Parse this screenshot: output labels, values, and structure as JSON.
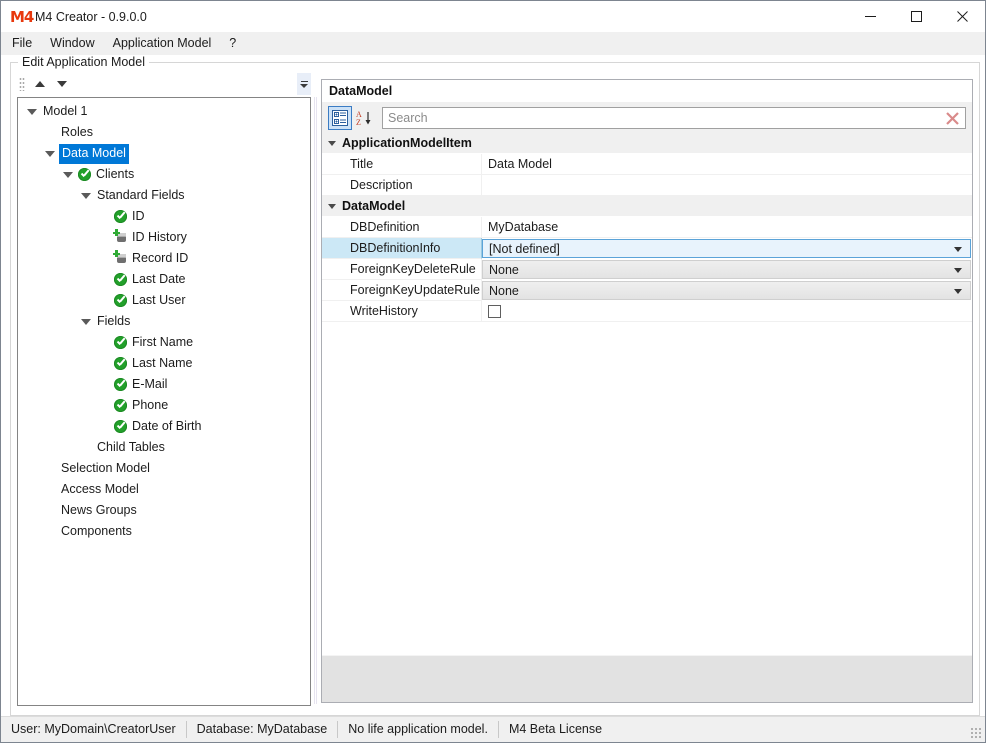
{
  "window": {
    "title": "M4 Creator - 0.9.0.0",
    "logo_text": "M4",
    "minimize_label": "Minimize",
    "maximize_label": "Maximize",
    "close_label": "Close"
  },
  "menubar": {
    "items": [
      {
        "label": "File"
      },
      {
        "label": "Window"
      },
      {
        "label": "Application Model"
      },
      {
        "label": "?"
      }
    ]
  },
  "groupbox": {
    "legend": "Edit Application Model"
  },
  "tree_toolbar": {
    "move_up_label": "Move Up",
    "move_down_label": "Move Down",
    "overflow_label": "Toolbar Overflow"
  },
  "tree": {
    "nodes": [
      {
        "label": "Model 1",
        "indent": 0,
        "expander": "open",
        "icon": "none",
        "selected": false
      },
      {
        "label": "Roles",
        "indent": 1,
        "expander": "none",
        "icon": "none",
        "selected": false
      },
      {
        "label": "Data Model",
        "indent": 1,
        "expander": "open",
        "icon": "none",
        "selected": true
      },
      {
        "label": "Clients",
        "indent": 2,
        "expander": "open",
        "icon": "check",
        "selected": false
      },
      {
        "label": "Standard Fields",
        "indent": 3,
        "expander": "open",
        "icon": "none",
        "selected": false
      },
      {
        "label": "ID",
        "indent": 4,
        "expander": "none",
        "icon": "check",
        "selected": false
      },
      {
        "label": "ID History",
        "indent": 4,
        "expander": "none",
        "icon": "db",
        "selected": false
      },
      {
        "label": "Record ID",
        "indent": 4,
        "expander": "none",
        "icon": "db",
        "selected": false
      },
      {
        "label": "Last Date",
        "indent": 4,
        "expander": "none",
        "icon": "check",
        "selected": false
      },
      {
        "label": "Last User",
        "indent": 4,
        "expander": "none",
        "icon": "check",
        "selected": false
      },
      {
        "label": "Fields",
        "indent": 3,
        "expander": "open",
        "icon": "none",
        "selected": false
      },
      {
        "label": "First Name",
        "indent": 4,
        "expander": "none",
        "icon": "check",
        "selected": false
      },
      {
        "label": "Last Name",
        "indent": 4,
        "expander": "none",
        "icon": "check",
        "selected": false
      },
      {
        "label": "E-Mail",
        "indent": 4,
        "expander": "none",
        "icon": "check",
        "selected": false
      },
      {
        "label": "Phone",
        "indent": 4,
        "expander": "none",
        "icon": "check",
        "selected": false
      },
      {
        "label": "Date of Birth",
        "indent": 4,
        "expander": "none",
        "icon": "check",
        "selected": false
      },
      {
        "label": "Child Tables",
        "indent": 3,
        "expander": "none",
        "icon": "none",
        "selected": false
      },
      {
        "label": "Selection Model",
        "indent": 1,
        "expander": "none",
        "icon": "none",
        "selected": false
      },
      {
        "label": "Access Model",
        "indent": 1,
        "expander": "none",
        "icon": "none",
        "selected": false
      },
      {
        "label": "News Groups",
        "indent": 1,
        "expander": "none",
        "icon": "none",
        "selected": false
      },
      {
        "label": "Components",
        "indent": 1,
        "expander": "none",
        "icon": "none",
        "selected": false
      }
    ]
  },
  "property_pane": {
    "header": "DataModel",
    "toolbar": {
      "categorized_label": "Categorized",
      "alphabetical_label": "Alphabetical",
      "clear_search_label": "Clear Search"
    },
    "search": {
      "value": "",
      "placeholder": "Search"
    },
    "groups": [
      {
        "name": "ApplicationModelItem",
        "expanded": true,
        "rows": [
          {
            "name": "Title",
            "value": "Data Model",
            "editor": "text",
            "selected": false
          },
          {
            "name": "Description",
            "value": "",
            "editor": "text",
            "selected": false
          }
        ]
      },
      {
        "name": "DataModel",
        "expanded": true,
        "rows": [
          {
            "name": "DBDefinition",
            "value": "MyDatabase",
            "editor": "text",
            "selected": false
          },
          {
            "name": "DBDefinitionInfo",
            "value": "[Not defined]",
            "editor": "combo",
            "selected": true
          },
          {
            "name": "ForeignKeyDeleteRule",
            "value": "None",
            "editor": "combo",
            "selected": false
          },
          {
            "name": "ForeignKeyUpdateRule",
            "value": "None",
            "editor": "combo",
            "selected": false
          },
          {
            "name": "WriteHistory",
            "value": "",
            "editor": "checkbox",
            "checked": false,
            "selected": false
          }
        ]
      }
    ]
  },
  "statusbar": {
    "cells": [
      {
        "label": "User: MyDomain\\CreatorUser"
      },
      {
        "label": "Database: MyDatabase"
      },
      {
        "label": "No life application model."
      },
      {
        "label": "M4 Beta License"
      }
    ]
  },
  "colors": {
    "selection_blue": "#0078d7",
    "row_select_blue": "#cce8f6",
    "toolbar_gray": "#f0f0f0",
    "check_green": "#22a02a",
    "logo_orange": "#e8380d",
    "clear_red": "#d98a8a"
  }
}
